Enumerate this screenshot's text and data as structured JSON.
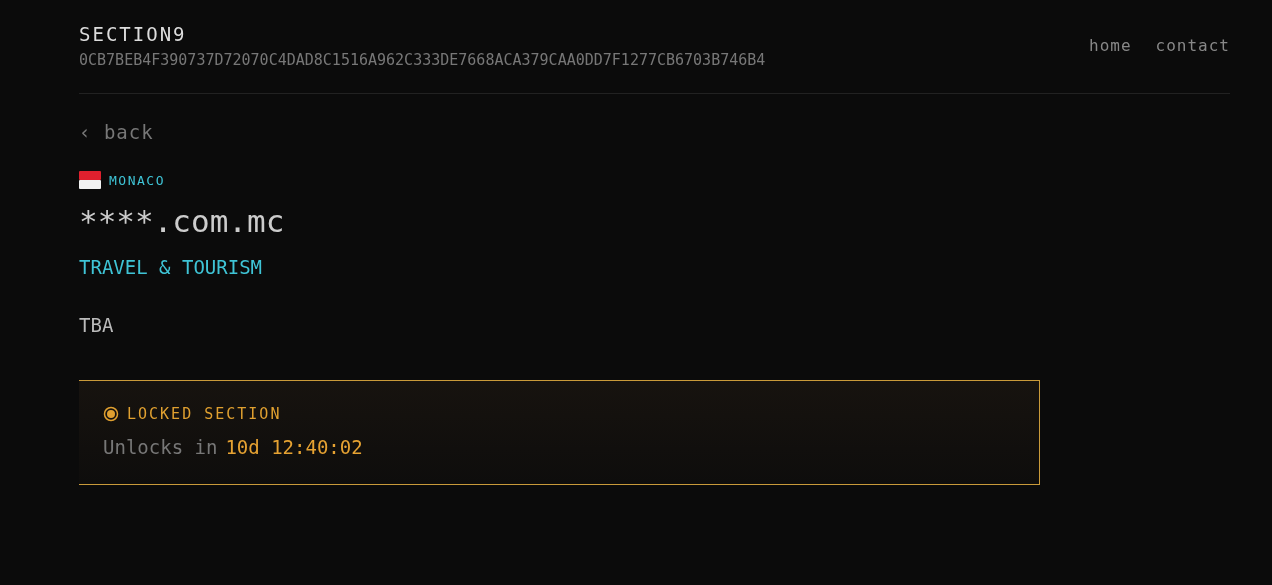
{
  "header": {
    "title": "SECTION9",
    "hash": "0CB7BEB4F390737D72070C4DAD8C1516A962C333DE7668ACA379CAA0DD7F1277CB6703B746B4"
  },
  "nav": [
    {
      "label": "home"
    },
    {
      "label": "contact"
    }
  ],
  "back_link": "‹ back",
  "country": "MONACO",
  "domain": "****.com.mc",
  "category": "TRAVEL & TOURISM",
  "description": "TBA",
  "lock_panel": {
    "locked": true,
    "title": "LOCKED SECTION",
    "label": "Unlocks in",
    "countdown": "10d 12:40:02"
  }
}
